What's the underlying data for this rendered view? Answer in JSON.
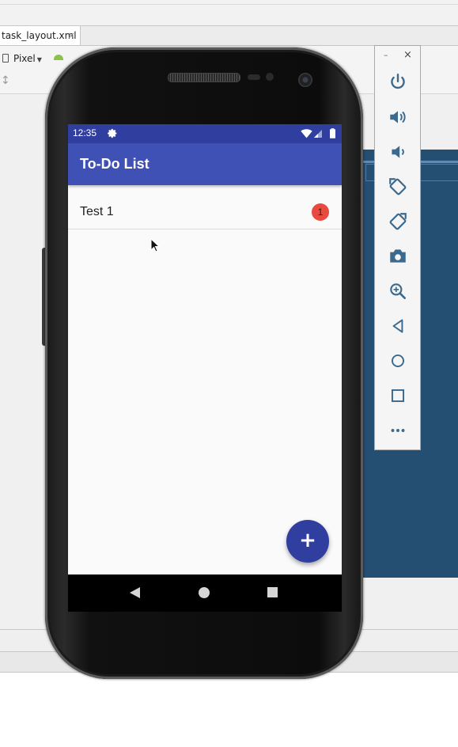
{
  "ide": {
    "file_tab_label": "task_layout.xml",
    "file_tab_close": "×",
    "device_selector_label": "Pixel"
  },
  "device": {
    "status_bar": {
      "time": "12:35"
    },
    "app_bar": {
      "title": "To-Do List"
    },
    "list": {
      "items": [
        {
          "label": "Test 1",
          "badge": "1"
        }
      ]
    },
    "fab_label": "+"
  },
  "emulator_panel": {
    "minimize_label": "–",
    "close_label": "×",
    "buttons": [
      "power-icon",
      "volume-up-icon",
      "volume-down-icon",
      "rotate-left-icon",
      "rotate-right-icon",
      "camera-icon",
      "zoom-icon",
      "back-icon",
      "home-icon",
      "overview-icon",
      "more-icon"
    ]
  },
  "colors": {
    "status_bar": "#303f9f",
    "app_bar": "#3f51b5",
    "fab": "#303f9f",
    "badge": "#e94a3f",
    "panel_icon": "#3b6a8e"
  }
}
